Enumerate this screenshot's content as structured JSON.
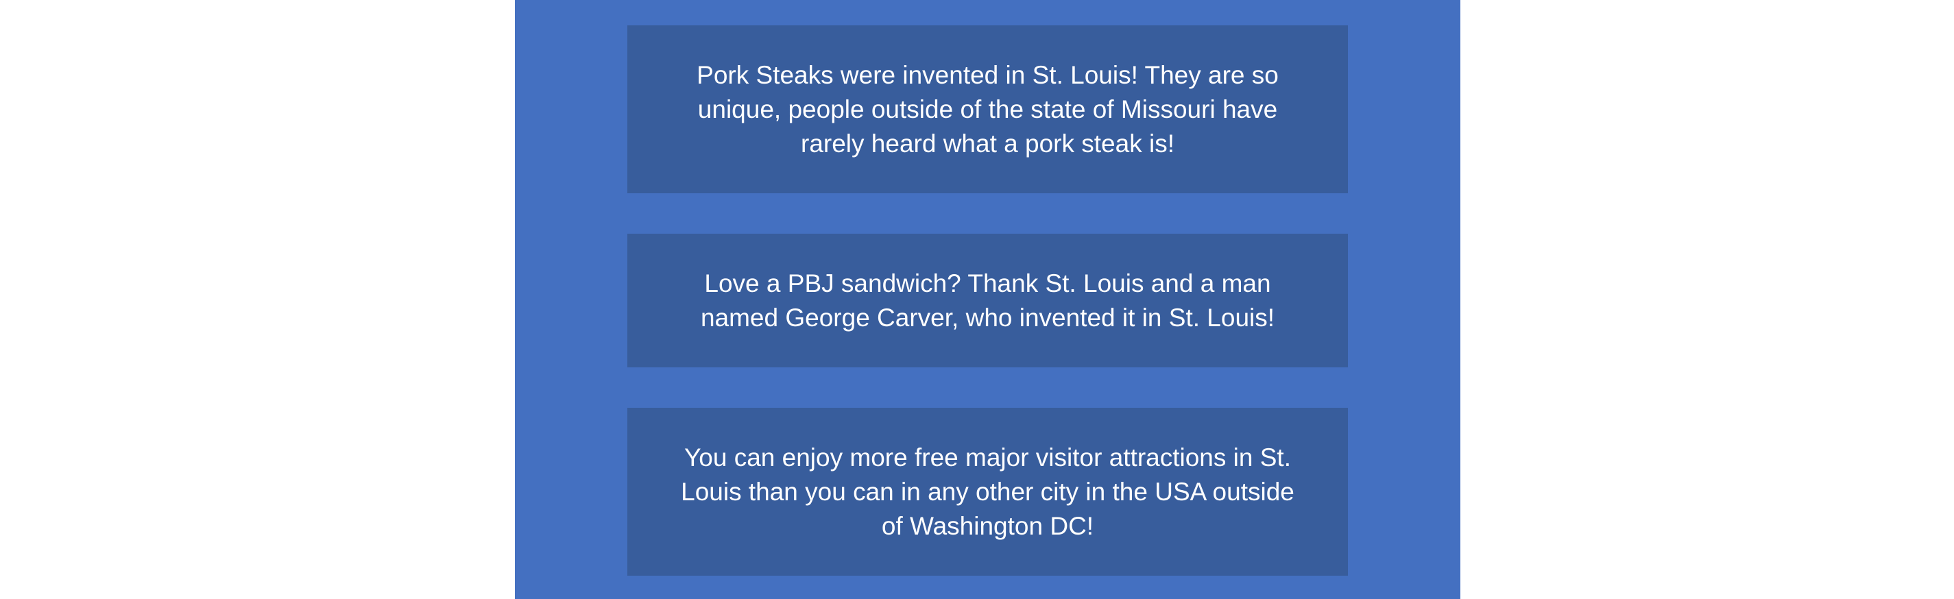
{
  "facts": [
    {
      "text": "Pork Steaks were invented in St. Louis! They are so unique, people outside of the state of Missouri have rarely heard what a pork steak is!"
    },
    {
      "text": "Love a PBJ sandwich? Thank St. Louis and a man named George Carver, who invented it in St. Louis!"
    },
    {
      "text": "You can enjoy more free major visitor attractions in St. Louis than you can in any other city in the USA outside of Washington DC!"
    }
  ],
  "colors": {
    "page_background": "#ffffff",
    "column_background": "#4470c1",
    "card_background": "#385d9c",
    "text": "#ffffff"
  }
}
